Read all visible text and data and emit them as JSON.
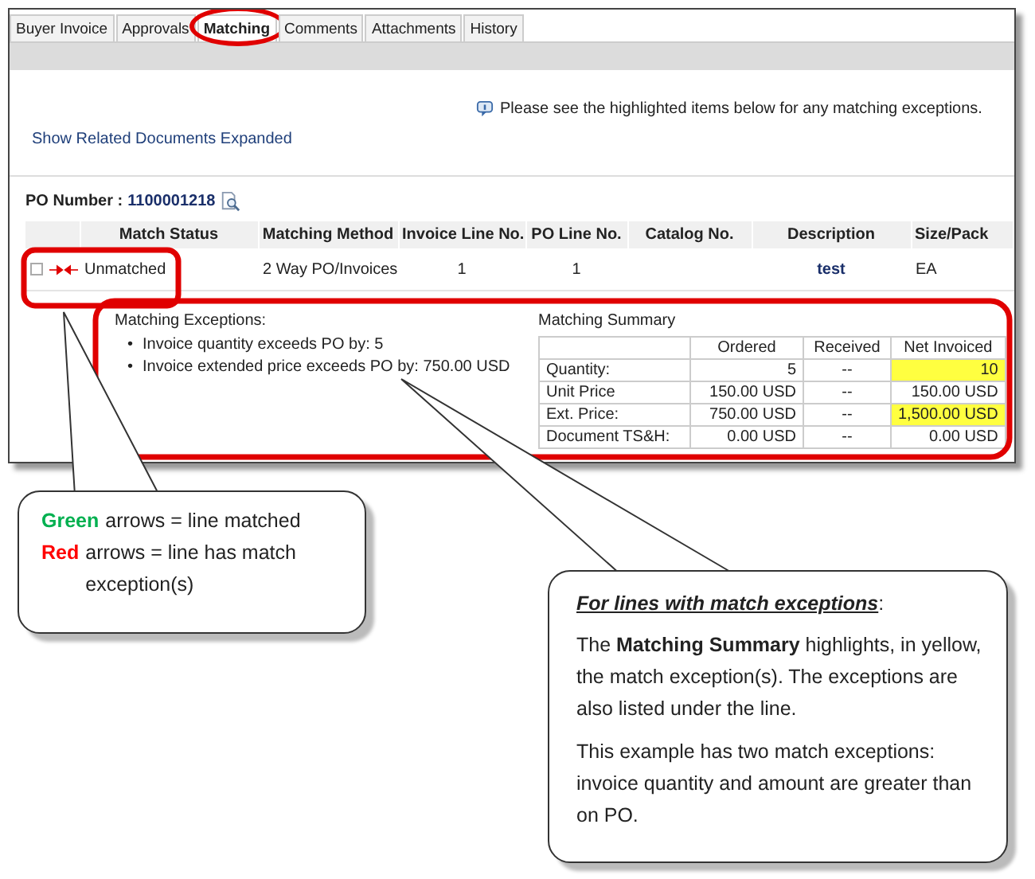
{
  "tabs": [
    {
      "label": "Buyer Invoice",
      "selected": false
    },
    {
      "label": "Approvals",
      "selected": false
    },
    {
      "label": "Matching",
      "selected": true
    },
    {
      "label": "Comments",
      "selected": false
    },
    {
      "label": "Attachments",
      "selected": false
    },
    {
      "label": "History",
      "selected": false
    }
  ],
  "notice": "Please see the highlighted items below for any matching exceptions.",
  "related_link": "Show Related Documents Expanded",
  "po": {
    "label": "PO Number :",
    "number": "1100001218"
  },
  "table": {
    "columns": [
      "Match Status",
      "Matching Method",
      "Invoice Line No.",
      "PO Line No.",
      "Catalog No.",
      "Description",
      "Size/Pack"
    ],
    "rows": [
      {
        "matched": false,
        "status": "Unmatched",
        "method": "2 Way PO/Invoices",
        "invoice_line": "1",
        "po_line": "1",
        "description": "test",
        "size_pack": "EA"
      }
    ]
  },
  "exceptions": {
    "title": "Matching Exceptions:",
    "items": [
      {
        "marker": "•",
        "text": "Invoice quantity exceeds PO by: 5"
      },
      {
        "marker": "•",
        "text": "Invoice extended price exceeds PO by: 750.00 USD"
      }
    ]
  },
  "summary": {
    "title": "Matching Summary",
    "columns": [
      "Ordered",
      "Received",
      "Net Invoiced"
    ],
    "rows": [
      {
        "label": "Quantity:",
        "cells": [
          {
            "text": "5",
            "highlighted": false
          },
          {
            "text": "--",
            "highlighted": false
          },
          {
            "text": "10",
            "highlighted": true
          }
        ]
      },
      {
        "label": "Unit Price",
        "cells": [
          {
            "text": "150.00 USD",
            "highlighted": false
          },
          {
            "text": "--",
            "highlighted": false
          },
          {
            "text": "150.00 USD",
            "highlighted": false
          }
        ]
      },
      {
        "label": "Ext. Price:",
        "cells": [
          {
            "text": "750.00 USD",
            "highlighted": false
          },
          {
            "text": "--",
            "highlighted": false
          },
          {
            "text": "1,500.00 USD",
            "highlighted": true
          }
        ]
      },
      {
        "label": "Document TS&H:",
        "cells": [
          {
            "text": "0.00 USD",
            "highlighted": false
          },
          {
            "text": "--",
            "highlighted": false
          },
          {
            "text": "0.00 USD",
            "highlighted": false
          }
        ]
      }
    ]
  },
  "legend": [
    {
      "key": "Green",
      "color": "#00b050",
      "text": "arrows = line matched"
    },
    {
      "key": "Red",
      "color": "#ff0000",
      "text": "arrows = line has match exception(s)"
    }
  ],
  "note": {
    "heading": "**For lines with match exceptions**:",
    "paragraphs": [
      "The **Matching Summary** highlights, in yellow, the match exception(s). The exceptions are also listed under the line.",
      "This example has two match exceptions: invoice quantity and amount are greater than on PO."
    ]
  }
}
